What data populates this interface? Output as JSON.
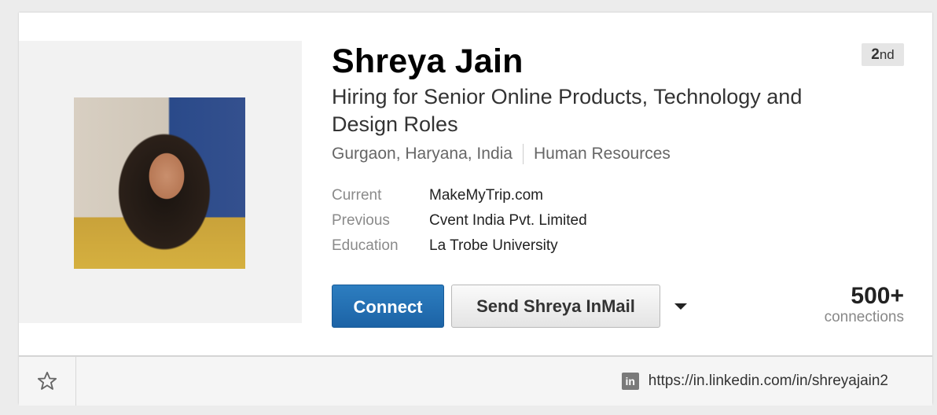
{
  "profile": {
    "name": "Shreya Jain",
    "degree_number": "2",
    "degree_suffix": "nd",
    "headline": "Hiring for Senior Online Products, Technology and Design Roles",
    "location": "Gurgaon, Haryana, India",
    "industry": "Human Resources"
  },
  "info": [
    {
      "label": "Current",
      "value": "MakeMyTrip.com"
    },
    {
      "label": "Previous",
      "value": "Cvent India Pvt. Limited"
    },
    {
      "label": "Education",
      "value": "La Trobe University"
    }
  ],
  "actions": {
    "connect_label": "Connect",
    "inmail_label": "Send Shreya InMail",
    "more_icon": "caret-down-icon"
  },
  "connections": {
    "count": "500+",
    "label": "connections"
  },
  "footer": {
    "star_icon": "star-icon",
    "linkedin_icon": "linkedin-icon",
    "url": "https://in.linkedin.com/in/shreyajain2"
  },
  "colors": {
    "primary_button": "#1c63a6",
    "background": "#ececec",
    "card": "#ffffff"
  }
}
